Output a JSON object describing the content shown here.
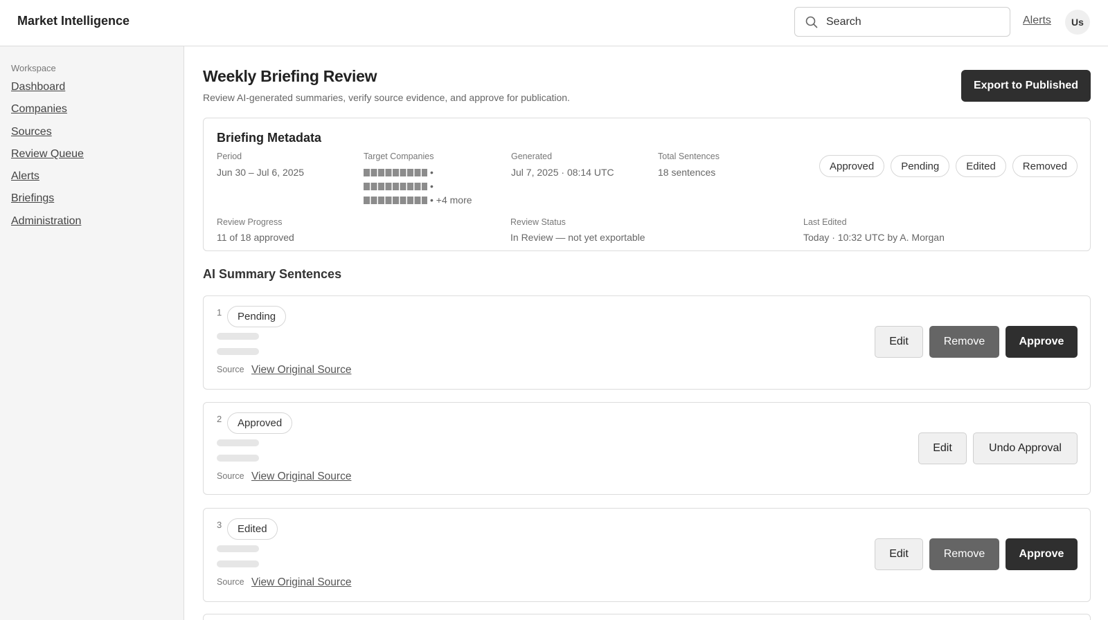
{
  "header": {
    "app_title": "Market Intelligence",
    "search_placeholder": "Search",
    "alerts_label": "Alerts",
    "avatar_initials": "Us"
  },
  "sidebar": {
    "heading": "Workspace",
    "items": [
      {
        "label": "Dashboard"
      },
      {
        "label": "Companies"
      },
      {
        "label": "Sources"
      },
      {
        "label": "Review Queue"
      },
      {
        "label": "Alerts"
      },
      {
        "label": "Briefings"
      },
      {
        "label": "Administration"
      }
    ]
  },
  "page": {
    "title": "Weekly Briefing Review",
    "subtitle": "Review AI-generated summaries, verify source evidence, and approve for publication.",
    "export_label": "Export to Published"
  },
  "metadata": {
    "title": "Briefing Metadata",
    "period_label": "Period",
    "period_value": "Jun 30 – Jul 6, 2025",
    "companies_label": "Target Companies",
    "companies_sep": "•",
    "companies_more": "• +4 more",
    "generated_label": "Generated",
    "generated_value": "Jul 7, 2025 · 08:14 UTC",
    "total_label": "Total Sentences",
    "total_value": "18 sentences",
    "progress_label": "Review Progress",
    "progress_value": "11 of 18 approved",
    "status_label": "Review Status",
    "status_value": "In Review — not yet exportable",
    "last_edited_label": "Last Edited",
    "last_edited_value": "Today · 10:32 UTC by A. Morgan",
    "legend_chips": [
      "Approved",
      "Pending",
      "Edited",
      "Removed"
    ]
  },
  "sentences": {
    "section_title": "AI Summary Sentences",
    "source_label": "Source",
    "source_link": "View Original Source",
    "edit_label": "Edit",
    "remove_label": "Remove",
    "approve_label": "Approve",
    "undo_label": "Undo Approval",
    "items": [
      {
        "number": "1",
        "status": "Pending"
      },
      {
        "number": "2",
        "status": "Approved"
      },
      {
        "number": "3",
        "status": "Edited"
      }
    ]
  }
}
